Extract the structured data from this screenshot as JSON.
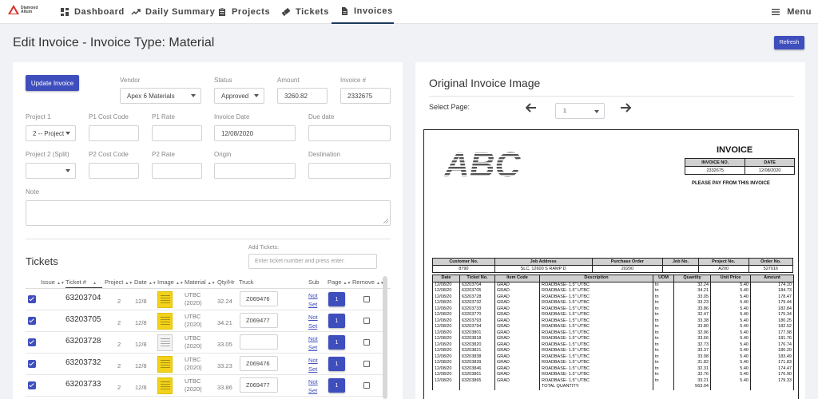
{
  "nav": {
    "logo_text_1": "Diamond",
    "logo_text_2": "Altum",
    "items": [
      {
        "label": "Dashboard",
        "icon": "dashboard-icon"
      },
      {
        "label": "Daily Summary",
        "icon": "trend-icon"
      },
      {
        "label": "Projects",
        "icon": "clipboard-icon"
      },
      {
        "label": "Tickets",
        "icon": "ticket-icon"
      },
      {
        "label": "Invoices",
        "icon": "file-icon",
        "active": true
      }
    ],
    "menu_label": "Menu"
  },
  "header": {
    "title": "Edit Invoice - Invoice Type: Material",
    "refresh_label": "Refresh"
  },
  "form": {
    "update_label": "Update Invoice",
    "vendor_label": "Vendor",
    "vendor_value": "Apex 6 Materials",
    "status_label": "Status",
    "status_value": "Approved",
    "amount_label": "Amount",
    "amount_value": "3260.82",
    "invoice_no_label": "Invoice #",
    "invoice_no_value": "2332675",
    "project1_label": "Project 1",
    "project1_value": "2 -- Project",
    "p1_cost_label": "P1 Cost Code",
    "p1_rate_label": "P1 Rate",
    "invoice_date_label": "Invoice Date",
    "invoice_date_value": "12/08/2020",
    "due_date_label": "Due date",
    "project2_label": "Project 2 (Split)",
    "p2_cost_label": "P2 Cost Code",
    "p2_rate_label": "P2 Rate",
    "origin_label": "Origin",
    "destination_label": "Destination",
    "note_label": "Note"
  },
  "tickets": {
    "title": "Tickets",
    "add_label": "Add Tickets:",
    "add_placeholder": "Enter ticket number and press enter.",
    "columns": {
      "issue": "Issue",
      "ticket": "Ticket #",
      "project": "Project",
      "date": "Date",
      "image": "Image",
      "material": "Material",
      "qty": "Qty/Hr",
      "truck": "Truck",
      "sub": "Sub",
      "page": "Page",
      "remove": "Remove"
    },
    "rows": [
      {
        "ticket": "63203704",
        "project": "2",
        "date": "12/8",
        "mat1": "UTBC",
        "mat2": "(2020)",
        "qty": "32.24",
        "truck": "Z069476",
        "sub1": "Not",
        "sub2": "Set",
        "page": "1",
        "thumb": "yellow"
      },
      {
        "ticket": "63203705",
        "project": "2",
        "date": "12/8",
        "mat1": "UTBC",
        "mat2": "(2020)",
        "qty": "34.21",
        "truck": "Z069477",
        "sub1": "Not",
        "sub2": "Set",
        "page": "1",
        "thumb": "yellow"
      },
      {
        "ticket": "63203728",
        "project": "2",
        "date": "12/8",
        "mat1": "UTBC",
        "mat2": "(2020)",
        "qty": "33.05",
        "truck": "",
        "sub1": "Not",
        "sub2": "Set",
        "page": "1",
        "thumb": "white"
      },
      {
        "ticket": "63203732",
        "project": "2",
        "date": "12/8",
        "mat1": "UTBC",
        "mat2": "(2020)",
        "qty": "33.23",
        "truck": "Z069476",
        "sub1": "Not",
        "sub2": "Set",
        "page": "1",
        "thumb": "yellow"
      },
      {
        "ticket": "63203733",
        "project": "2",
        "date": "12/8",
        "mat1": "UTBC",
        "mat2": "(2020)",
        "qty": "33.86",
        "truck": "Z069477",
        "sub1": "Not",
        "sub2": "Set",
        "page": "1",
        "thumb": "yellow"
      }
    ]
  },
  "original": {
    "title": "Original Invoice Image",
    "select_page_label": "Select Page:",
    "page_value": "1"
  },
  "invoice_doc": {
    "logo": "ABC",
    "title": "INVOICE",
    "meta_headers": [
      "INVOICE NO.",
      "DATE"
    ],
    "meta_values": [
      "2332675",
      "12/08/2020"
    ],
    "pay_text": "PLEASE PAY FROM THIS INVOICE",
    "info_headers": [
      "Customer No.",
      "Job Address",
      "Purchase Order",
      "Job No.",
      "Project No.",
      "Order No."
    ],
    "info_values": [
      "8790",
      "SLC, 12600 S RAMP D",
      "20200",
      "",
      "A200",
      "527016"
    ],
    "line_headers": [
      "Date",
      "Ticket No.",
      "Item Code",
      "Description",
      "UOM",
      "Quantity",
      "Unit Price",
      "Amount"
    ],
    "lines": [
      [
        "12/08/20",
        "63203704",
        "GRAD",
        "ROADBASE- 1.5\" UTBC",
        "tn",
        "32.24",
        "5.40",
        "174.10"
      ],
      [
        "12/08/20",
        "63203705",
        "GRAD",
        "ROADBASE- 1.5\" UTBC",
        "tn",
        "34.21",
        "5.40",
        "184.73"
      ],
      [
        "12/08/20",
        "63203728",
        "GRAD",
        "ROADBASE- 1.5\" UTBC",
        "tn",
        "33.05",
        "5.40",
        "178.47"
      ],
      [
        "12/08/20",
        "63203732",
        "GRAD",
        "ROADBASE- 1.5\" UTBC",
        "tn",
        "33.23",
        "5.40",
        "179.44"
      ],
      [
        "12/08/20",
        "63203733",
        "GRAD",
        "ROADBASE- 1.5\" UTBC",
        "tn",
        "33.86",
        "5.40",
        "182.84"
      ],
      [
        "12/08/20",
        "63203770",
        "GRAD",
        "ROADBASE- 1.5\" UTBC",
        "tn",
        "32.47",
        "5.40",
        "175.34"
      ],
      [
        "12/08/20",
        "63203793",
        "GRAD",
        "ROADBASE- 1.5\" UTBC",
        "tn",
        "33.38",
        "5.40",
        "180.25"
      ],
      [
        "12/08/20",
        "63203794",
        "GRAD",
        "ROADBASE- 1.5\" UTBC",
        "tn",
        "33.80",
        "5.40",
        "182.52"
      ],
      [
        "12/08/20",
        "63203801",
        "GRAD",
        "ROADBASE- 1.5\" UTBC",
        "tn",
        "32.96",
        "5.40",
        "177.98"
      ],
      [
        "12/08/20",
        "63203818",
        "GRAD",
        "ROADBASE- 1.5\" UTBC",
        "tn",
        "33.66",
        "5.40",
        "181.76"
      ],
      [
        "12/08/20",
        "63203820",
        "GRAD",
        "ROADBASE- 1.5\" UTBC",
        "tn",
        "32.73",
        "5.40",
        "176.74"
      ],
      [
        "12/08/20",
        "63203821",
        "GRAD",
        "ROADBASE- 1.5\" UTBC",
        "tn",
        "33.37",
        "5.40",
        "180.20"
      ],
      [
        "12/08/20",
        "63203838",
        "GRAD",
        "ROADBASE- 1.5\" UTBC",
        "tn",
        "33.98",
        "5.40",
        "183.49"
      ],
      [
        "12/08/20",
        "63203839",
        "GRAD",
        "ROADBASE- 1.5\" UTBC",
        "tn",
        "31.82",
        "5.40",
        "171.83"
      ],
      [
        "12/08/20",
        "63203846",
        "GRAD",
        "ROADBASE- 1.5\" UTBC",
        "tn",
        "32.31",
        "5.40",
        "174.47"
      ],
      [
        "12/08/20",
        "63203861",
        "GRAD",
        "ROADBASE- 1.5\" UTBC",
        "tn",
        "32.76",
        "5.40",
        "176.90"
      ],
      [
        "12/08/20",
        "63203865",
        "GRAD",
        "ROADBASE- 1.5\" UTBC",
        "tn",
        "33.21",
        "5.40",
        "179.33"
      ]
    ],
    "total_label": "TOTAL QUANTITY:",
    "total_value": "563.04"
  }
}
